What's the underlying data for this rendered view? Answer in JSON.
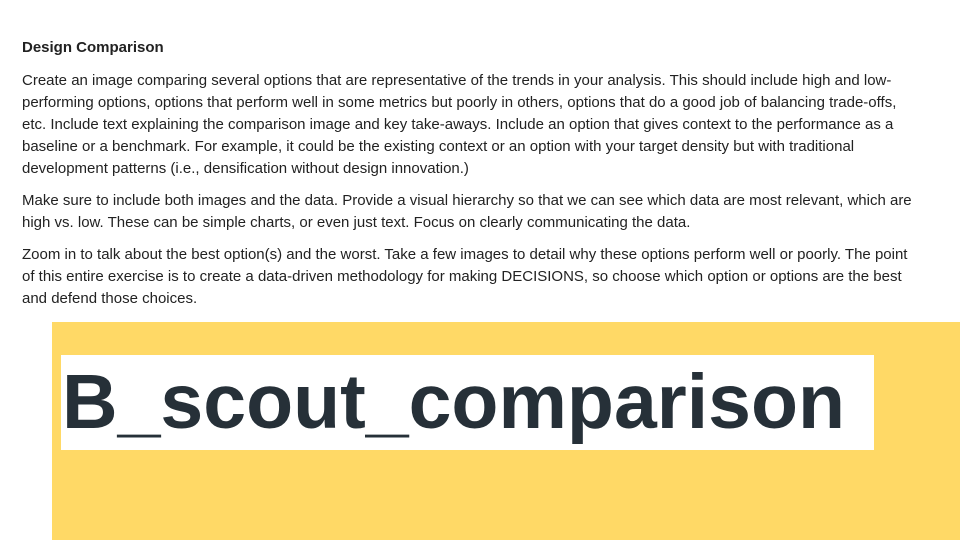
{
  "heading": "Design Comparison",
  "paragraphs": [
    "Create an image comparing several options that are representative of the trends in your analysis. This should include high and low-performing options, options that perform well in some metrics but poorly in others, options that do a good job of balancing trade-offs, etc. Include text explaining the comparison image and key take-aways. Include an option that gives context to the performance as a baseline or a benchmark. For example, it could be the existing context or an option with your target density but with traditional development patterns (i.e., densification without design innovation.)",
    "Make sure to include both images and the data. Provide a visual hierarchy so that we can see which data are most relevant, which are high vs. low. These can be simple charts, or even just text. Focus on clearly communicating the data.",
    "Zoom in to talk about the best option(s) and the worst. Take a few images to detail why these options perform well or poorly. The point of this entire exercise is to create a data-driven methodology for making DECISIONS, so choose which option or options are the best and defend those choices."
  ],
  "placeholder": {
    "label": "B_scout_comparison",
    "banner_color": "#ffd966",
    "label_color": "#263038"
  }
}
